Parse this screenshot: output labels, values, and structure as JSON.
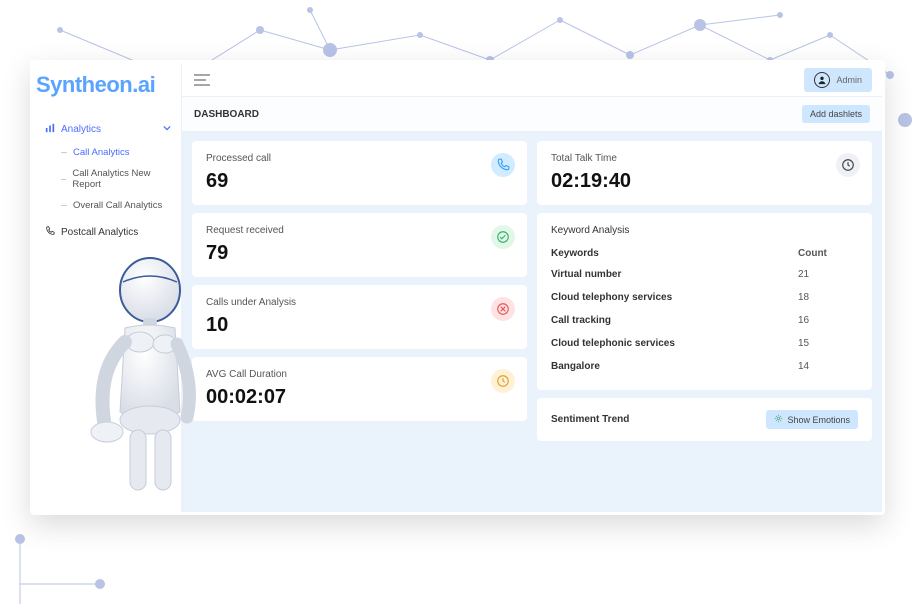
{
  "logo": "Syntheon.ai",
  "sidebar": {
    "analytics_label": "Analytics",
    "items": [
      {
        "label": "Call Analytics"
      },
      {
        "label": "Call Analytics New Report"
      },
      {
        "label": "Overall Call Analytics"
      }
    ],
    "postcall_label": "Postcall Analytics"
  },
  "header": {
    "user_label": "Admin",
    "title": "DASHBOARD",
    "add_button": "Add dashlets"
  },
  "cards": {
    "processed": {
      "title": "Processed call",
      "value": "69"
    },
    "requests": {
      "title": "Request received",
      "value": "79"
    },
    "under": {
      "title": "Calls under Analysis",
      "value": "10"
    },
    "avg": {
      "title": "AVG Call Duration",
      "value": "00:02:07"
    },
    "talk": {
      "title": "Total Talk Time",
      "value": "02:19:40"
    }
  },
  "keywords": {
    "title": "Keyword Analysis",
    "head_k": "Keywords",
    "head_v": "Count",
    "rows": [
      {
        "k": "Virtual number",
        "v": "21"
      },
      {
        "k": "Cloud telephony services",
        "v": "18"
      },
      {
        "k": "Call tracking",
        "v": "16"
      },
      {
        "k": "Cloud telephonic services",
        "v": "15"
      },
      {
        "k": "Bangalore",
        "v": "14"
      }
    ]
  },
  "sentiment": {
    "title": "Sentiment Trend",
    "button": "Show Emotions"
  }
}
